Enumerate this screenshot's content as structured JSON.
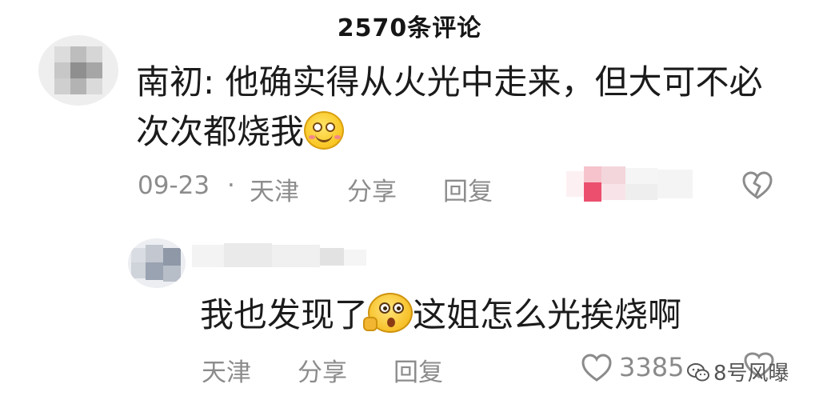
{
  "header": {
    "title": "2570条评论"
  },
  "comments": [
    {
      "author": "南初",
      "text_prefix": "南初: 他确实得从火光中走来，但大可不必次次都烧我",
      "emoji": "smile-blush-emoji",
      "meta": {
        "date": "09-23",
        "separator": "·",
        "location": "天津",
        "share": "分享",
        "reply": "回复"
      },
      "like_icon": "broken-heart-icon"
    },
    {
      "text_before_emoji": "我也发现了",
      "emoji": "shocked-face-emoji",
      "text_after_emoji": "这姐怎么光挨烧啊",
      "meta": {
        "location": "天津",
        "share": "分享",
        "reply": "回复"
      },
      "likes": "3385",
      "like_icon": "heart-icon",
      "dislike_icon": "broken-heart-icon"
    }
  ],
  "watermark": {
    "text": "8号风曝",
    "icon": "wechat-icon"
  },
  "colors": {
    "meta_gray": "#8c8c8c",
    "text": "#1b1b1b",
    "blur_pink": "#f6c3cc",
    "blur_pink_strong": "#ec4f6e"
  }
}
